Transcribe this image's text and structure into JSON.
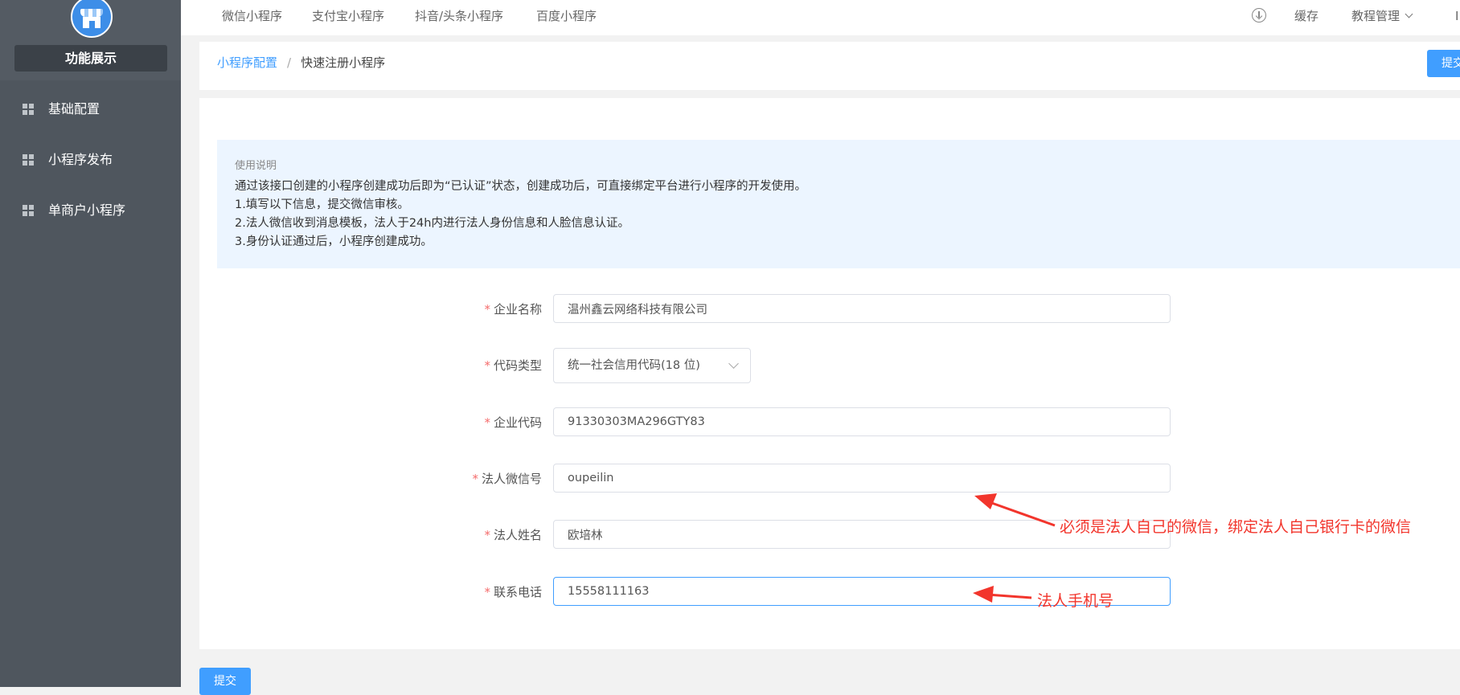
{
  "sidebar": {
    "brand_label": "功能展示",
    "items": [
      {
        "label": "基础配置",
        "icon": "grid-icon"
      },
      {
        "label": "小程序发布",
        "icon": "grid-icon"
      },
      {
        "label": "单商户小程序",
        "icon": "grid-icon"
      }
    ]
  },
  "topnav": {
    "tabs": [
      "微信小程序",
      "支付宝小程序",
      "抖音/头条小程序",
      "百度小程序"
    ],
    "right": {
      "download_icon": "download-circle-icon",
      "cache_label": "缓存",
      "tutorial_label": "教程管理",
      "truncated_label": "I"
    }
  },
  "breadcrumb": {
    "parent": "小程序配置",
    "separator": "/",
    "current": "快速注册小程序",
    "submit_label": "提交"
  },
  "notice": {
    "title": "使用说明",
    "lines": [
      "通过该接口创建的小程序创建成功后即为“已认证”状态，创建成功后，可直接绑定平台进行小程序的开发使用。",
      "1.填写以下信息，提交微信审核。",
      "2.法人微信收到消息模板，法人于24h内进行法人身份信息和人脸信息认证。",
      "3.身份认证通过后，小程序创建成功。"
    ]
  },
  "form": {
    "company_name": {
      "label": "企业名称",
      "value": "温州鑫云网络科技有限公司"
    },
    "code_type": {
      "label": "代码类型",
      "value": "统一社会信用代码(18 位)"
    },
    "company_code": {
      "label": "企业代码",
      "value": "91330303MA296GTY83"
    },
    "legal_wechat": {
      "label": "法人微信号",
      "value": "oupeilin"
    },
    "legal_name": {
      "label": "法人姓名",
      "value": "欧培林"
    },
    "phone": {
      "label": "联系电话",
      "value": "15558111163"
    },
    "required_mark": "*",
    "submit_label": "提交"
  },
  "annotations": {
    "wechat_note": "必须是法人自己的微信，绑定法人自己银行卡的微信",
    "phone_note": "法人手机号",
    "color": "#f2352c"
  },
  "colors": {
    "sidebar_bg": "#4f565e",
    "primary": "#409eff",
    "notice_bg": "#ecf5ff",
    "required": "#f56c6c"
  }
}
